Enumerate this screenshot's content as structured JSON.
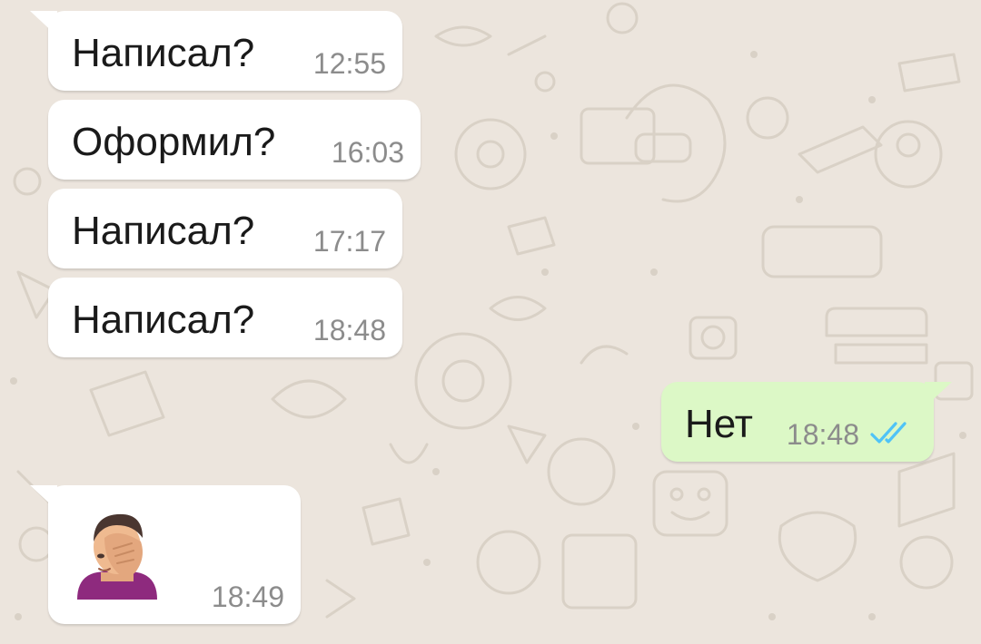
{
  "theme": {
    "background": "#ece5dd",
    "incoming_bubble": "#ffffff",
    "outgoing_bubble": "#dcf8c6",
    "time_color": "#8c8c8c",
    "read_ticks": "#4fc3f7"
  },
  "messages": [
    {
      "direction": "incoming",
      "text": "Написал?",
      "time": "12:55"
    },
    {
      "direction": "incoming",
      "text": "Оформил?",
      "time": "16:03"
    },
    {
      "direction": "incoming",
      "text": "Написал?",
      "time": "17:17"
    },
    {
      "direction": "incoming",
      "text": "Написал?",
      "time": "18:48"
    },
    {
      "direction": "outgoing",
      "text": "Нет",
      "time": "18:48",
      "status": "read",
      "status_icon": "double-check-icon"
    },
    {
      "direction": "incoming",
      "emoji": "facepalm-emoji",
      "time": "18:49"
    }
  ]
}
